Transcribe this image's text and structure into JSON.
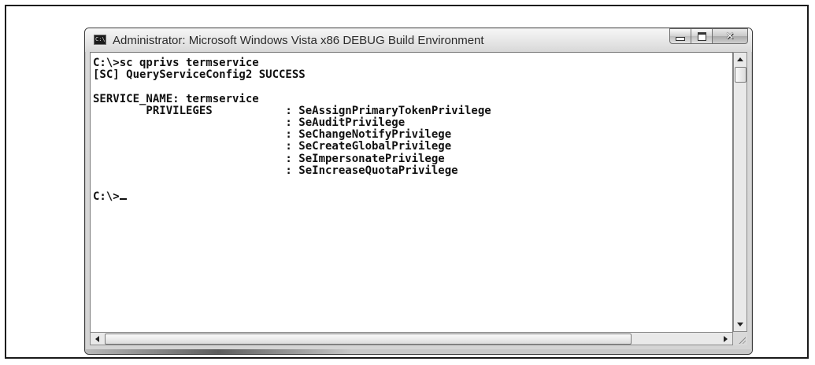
{
  "window": {
    "title": "Administrator: Microsoft Windows Vista x86 DEBUG Build Environment",
    "icon_label": "C:\\"
  },
  "console": {
    "lines": [
      "C:\\>sc qprivs termservice",
      "[SC] QueryServiceConfig2 SUCCESS",
      "",
      "SERVICE_NAME: termservice",
      "        PRIVILEGES           : SeAssignPrimaryTokenPrivilege",
      "                             : SeAuditPrivilege",
      "                             : SeChangeNotifyPrivilege",
      "                             : SeCreateGlobalPrivilege",
      "                             : SeImpersonatePrivilege",
      "                             : SeIncreaseQuotaPrivilege",
      ""
    ],
    "prompt": "C:\\>"
  },
  "icons": {
    "app": "console-app-icon",
    "minimize": "minimize-icon",
    "maximize": "maximize-icon",
    "close": "close-icon",
    "scroll_up": "arrow-up-icon",
    "scroll_down": "arrow-down-icon",
    "scroll_left": "arrow-left-icon",
    "scroll_right": "arrow-right-icon",
    "resize": "resize-grip-icon"
  }
}
